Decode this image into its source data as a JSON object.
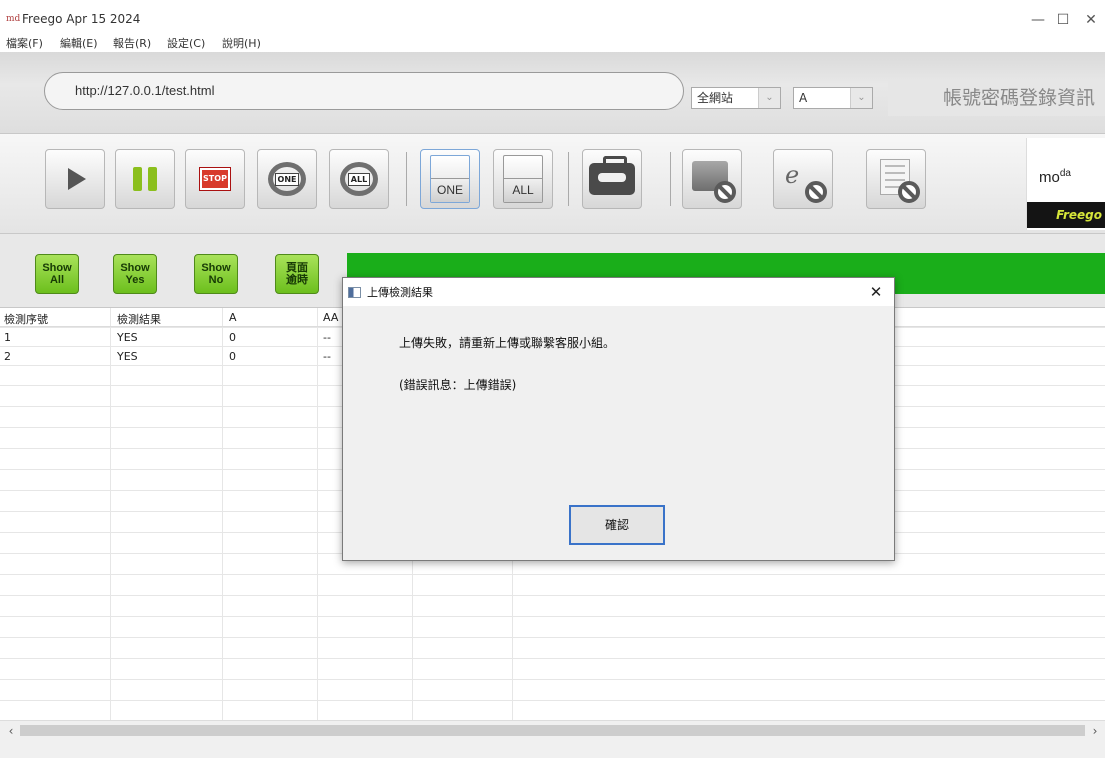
{
  "window": {
    "title": "Freego Apr 15 2024",
    "icon_text": "md"
  },
  "menu": [
    "檔案(F)",
    "編輯(E)",
    "報告(R)",
    "設定(C)",
    "說明(H)"
  ],
  "url": {
    "value": "http://127.0.0.1/test.html"
  },
  "selects": {
    "scope": "全網站",
    "level": "A"
  },
  "account_label": "帳號密碼登錄資訊",
  "toolbar": {
    "play": "play",
    "pause": "pause",
    "stop": "STOP",
    "refresh_one": "ONE",
    "refresh_all": "ALL",
    "doc_one": "ONE",
    "doc_all": "ALL"
  },
  "logo": {
    "moda_main": "mo",
    "moda_sup1": "d",
    "moda_sup2": "a",
    "freego": "Freego"
  },
  "filters": [
    {
      "line1": "Show",
      "line2": "All"
    },
    {
      "line1": "Show",
      "line2": "Yes"
    },
    {
      "line1": "Show",
      "line2": "No"
    },
    {
      "line1": "頁面",
      "line2": "逾時"
    }
  ],
  "table": {
    "headers": [
      "檢測序號",
      "檢測結果",
      "A",
      "AA"
    ],
    "rows": [
      [
        "1",
        "YES",
        "0",
        "--"
      ],
      [
        "2",
        "YES",
        "0",
        "--"
      ]
    ]
  },
  "dialog": {
    "title": "上傳檢測結果",
    "close": "✕",
    "message": "上傳失敗，請重新上傳或聯繫客服小組。",
    "detail": "(錯誤訊息：上傳錯誤)",
    "ok": "確認"
  },
  "colors": {
    "status_green": "#1aae1a",
    "button_green": "#7dc928",
    "accent_blue": "#3a73c9"
  }
}
